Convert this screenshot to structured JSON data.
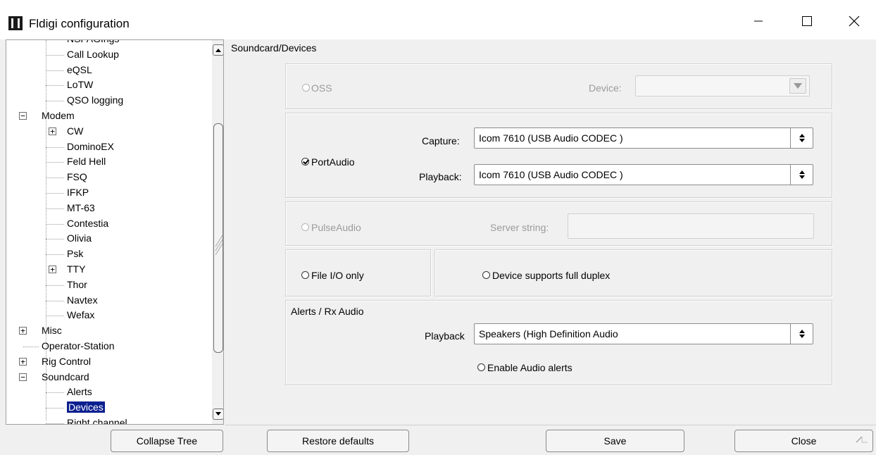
{
  "window": {
    "title": "Fldigi configuration"
  },
  "tree": {
    "items": [
      {
        "label": "NSPAGIngs",
        "level": 2
      },
      {
        "label": "Call Lookup",
        "level": 2
      },
      {
        "label": "eQSL",
        "level": 2
      },
      {
        "label": "LoTW",
        "level": 2
      },
      {
        "label": "QSO logging",
        "level": 2
      },
      {
        "label": "Modem",
        "level": 1,
        "expander": "−"
      },
      {
        "label": "CW",
        "level": 2,
        "expander": "+"
      },
      {
        "label": "DominoEX",
        "level": 2
      },
      {
        "label": "Feld Hell",
        "level": 2
      },
      {
        "label": "FSQ",
        "level": 2
      },
      {
        "label": "IFKP",
        "level": 2
      },
      {
        "label": "MT-63",
        "level": 2
      },
      {
        "label": "Contestia",
        "level": 2
      },
      {
        "label": "Olivia",
        "level": 2
      },
      {
        "label": "Psk",
        "level": 2
      },
      {
        "label": "TTY",
        "level": 2,
        "expander": "+"
      },
      {
        "label": "Thor",
        "level": 2
      },
      {
        "label": "Navtex",
        "level": 2
      },
      {
        "label": "Wefax",
        "level": 2
      },
      {
        "label": "Misc",
        "level": 1,
        "expander": "+"
      },
      {
        "label": "Operator-Station",
        "level": 1
      },
      {
        "label": "Rig Control",
        "level": 1,
        "expander": "+"
      },
      {
        "label": "Soundcard",
        "level": 1,
        "expander": "−"
      },
      {
        "label": "Alerts",
        "level": 2
      },
      {
        "label": "Devices",
        "level": 2,
        "selected": true
      },
      {
        "label": "Right channel",
        "level": 2
      }
    ]
  },
  "content": {
    "section_title": "Soundcard/Devices",
    "oss": {
      "label": "OSS",
      "device_label": "Device:"
    },
    "portaudio": {
      "label": "PortAudio",
      "capture_label": "Capture:",
      "capture_value": "Icom 7610 (USB Audio CODEC )",
      "playback_label": "Playback:",
      "playback_value": "Icom 7610  (USB Audio CODEC )"
    },
    "pulseaudio": {
      "label": "PulseAudio",
      "server_label": "Server string:"
    },
    "file_io": {
      "label": "File I/O only"
    },
    "full_duplex": {
      "label": "Device supports full duplex"
    },
    "alerts": {
      "title": "Alerts / Rx Audio",
      "playback_label": "Playback",
      "playback_value": "Speakers (High Definition Audio",
      "enable_label": "Enable Audio alerts"
    }
  },
  "buttons": {
    "collapse": "Collapse Tree",
    "restore": "Restore defaults",
    "save": "Save",
    "close": "Close"
  }
}
